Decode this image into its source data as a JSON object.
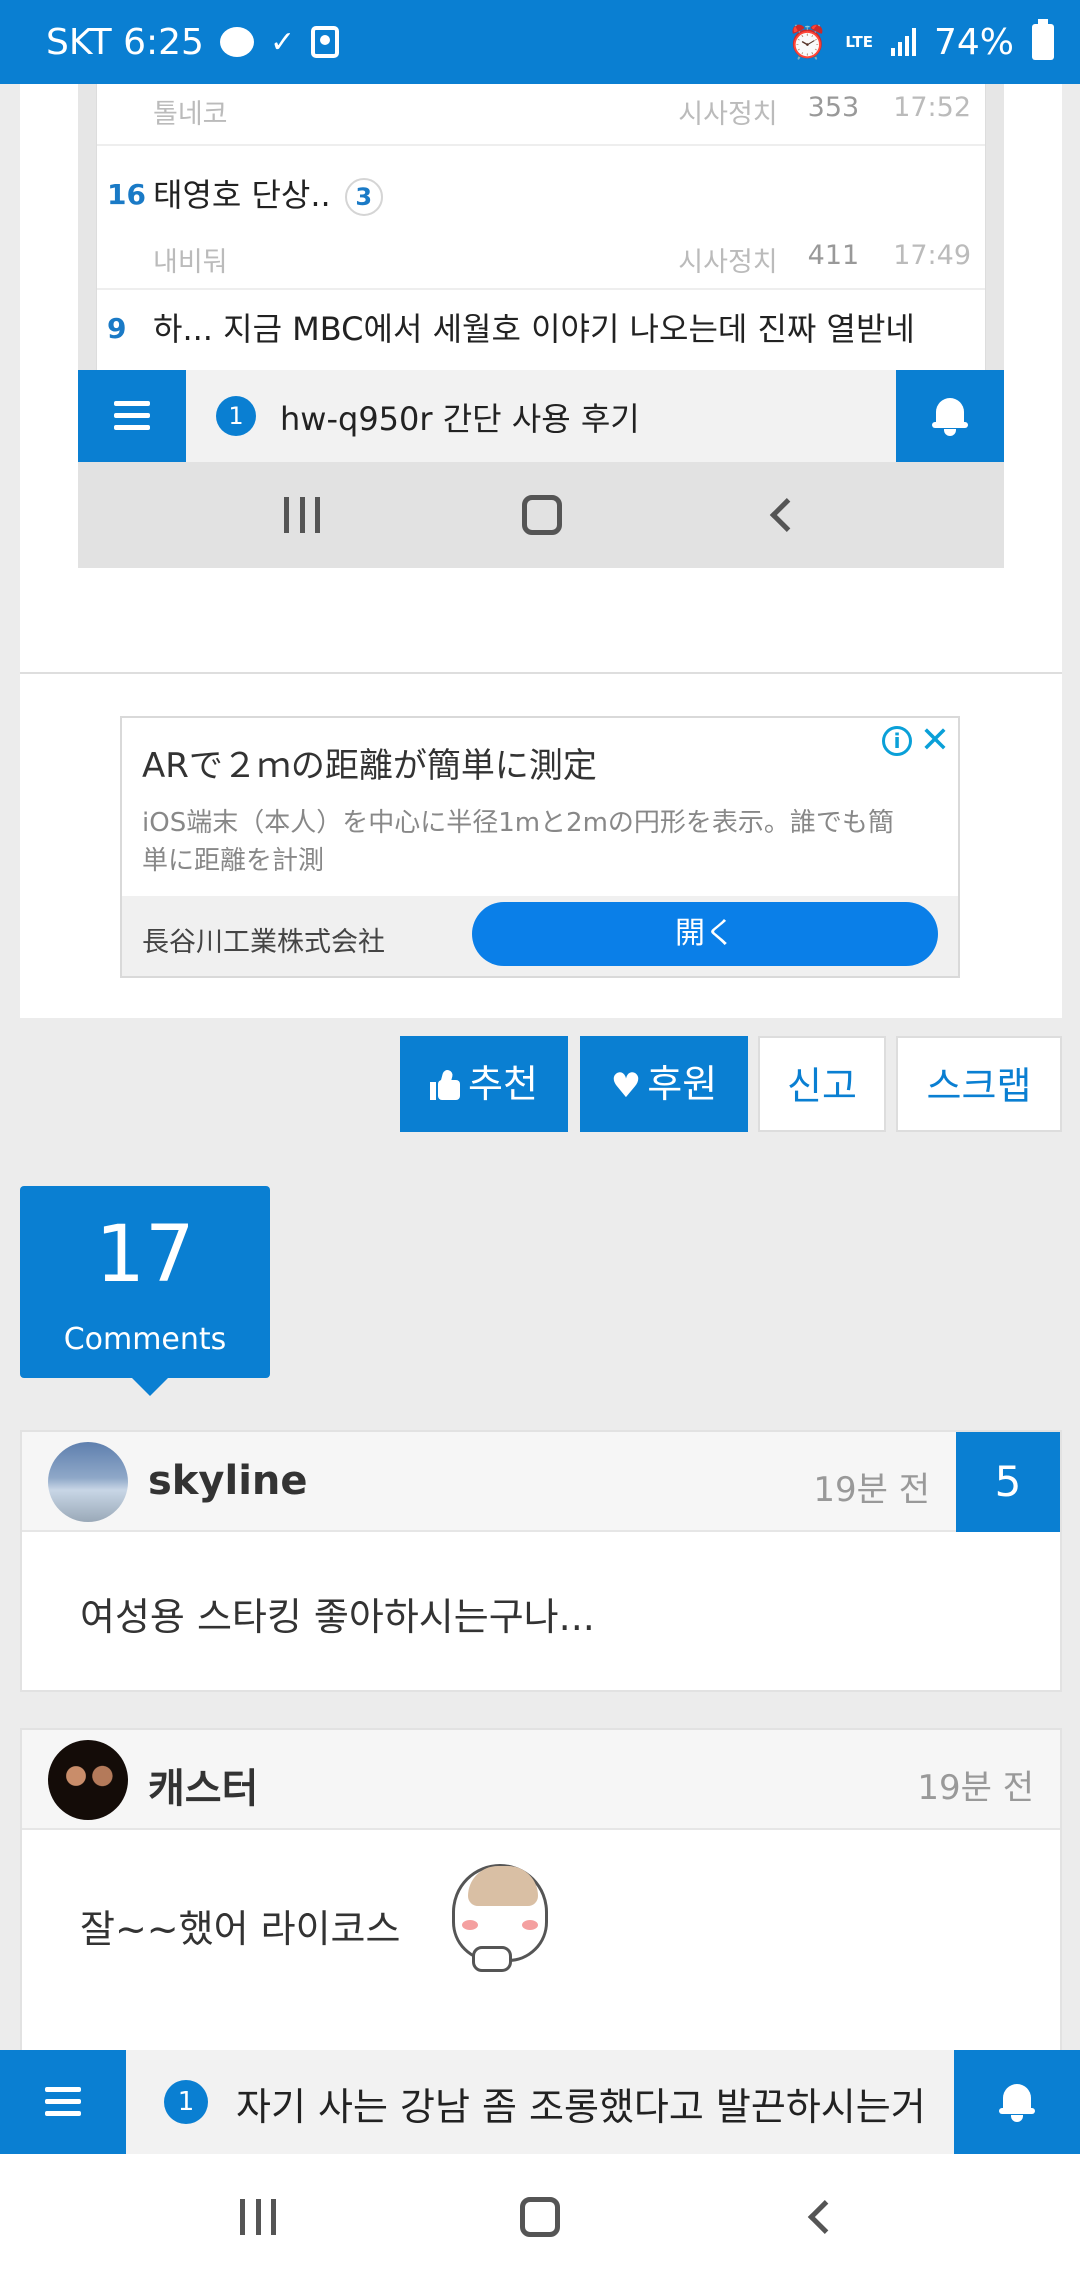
{
  "status_bar": {
    "carrier_time": "SKT 6:25",
    "network": "LTE",
    "battery": "74%",
    "icons": [
      "chat-icon",
      "vibrate-icon",
      "screen-record-icon",
      "alarm-icon",
      "lte-icon",
      "signal-icon",
      "battery-icon"
    ]
  },
  "embedded_list": {
    "rows": [
      {
        "num": "",
        "title": "",
        "author": "톨네코",
        "category": "시사정치",
        "views": "353",
        "time": "17:52"
      },
      {
        "num": "16",
        "title": "태영호 단상..",
        "comments": "3",
        "author": "내비둬",
        "category": "시사정치",
        "views": "411",
        "time": "17:49"
      },
      {
        "num": "9",
        "title": "하... 지금 MBC에서 세월호 이야기 나오는데 진짜 열받네",
        "author": "",
        "category": "",
        "views": "",
        "time": ""
      }
    ],
    "bar_badge": "1",
    "bar_title": "hw-q950r 간단 사용 후기"
  },
  "ad": {
    "title": "ARで２ｍの距離が簡単に測定",
    "description": "iOS端末（本人）を中心に半径1mと2mの円形を表示。誰でも簡単に距離を計測",
    "advertiser": "長谷川工業株式会社",
    "cta": "開く"
  },
  "actions": {
    "recommend": "추천",
    "support": "후원",
    "report": "신고",
    "scrap": "스크랩"
  },
  "comments_count": {
    "count": "17",
    "label": "Comments"
  },
  "comments": [
    {
      "author": "skyline",
      "time": "19분 전",
      "score": "5",
      "body": "여성용 스타킹 좋아하시는구나..."
    },
    {
      "author": "캐스터",
      "time": "19분 전",
      "score": "",
      "body": "잘~~했어 라이코스"
    }
  ],
  "bottom_bar": {
    "badge": "1",
    "title": "자기 사는 강남 좀 조롱했다고 발끈하시는거..."
  },
  "colors": {
    "accent": "#0a7fd2",
    "ad_button": "#0a7fe8"
  }
}
